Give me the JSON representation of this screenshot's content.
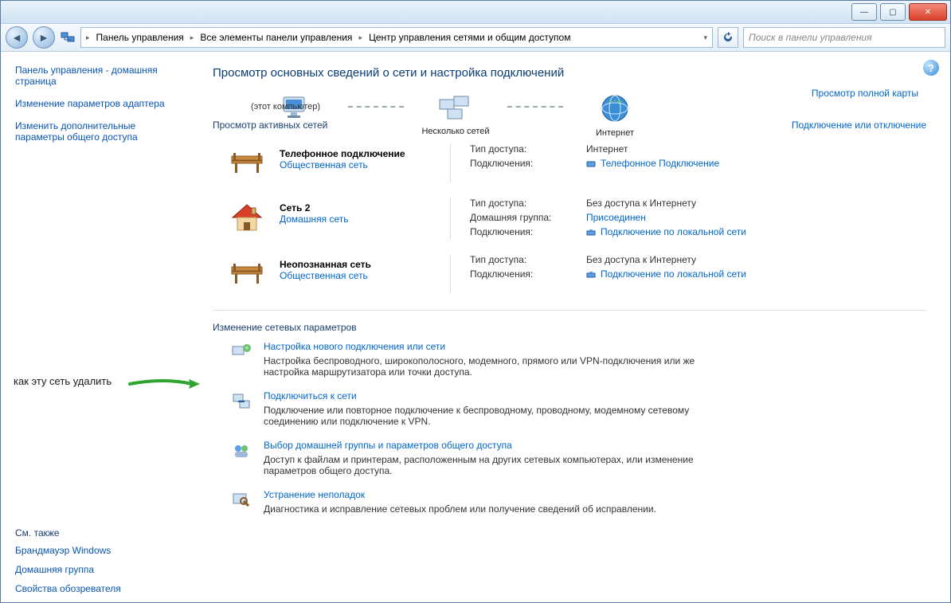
{
  "titlebar": {
    "min": "—",
    "max": "▢",
    "close": "✕"
  },
  "nav": {
    "back": "◄",
    "fwd": "►"
  },
  "breadcrumb": {
    "b1": "Панель управления",
    "b2": "Все элементы панели управления",
    "b3": "Центр управления сетями и общим доступом"
  },
  "search": {
    "placeholder": "Поиск в панели управления"
  },
  "sidebar": {
    "home": "Панель управления - домашняя страница",
    "adapter": "Изменение параметров адаптера",
    "sharing": "Изменить дополнительные параметры общего доступа",
    "see_also_heading": "См. также",
    "firewall": "Брандмауэр Windows",
    "homegroup": "Домашняя группа",
    "inetopt": "Свойства обозревателя"
  },
  "main": {
    "title": "Просмотр основных сведений о сети и настройка подключений",
    "fullmap": "Просмотр полной карты",
    "node_multi": "Несколько сетей",
    "node_internet": "Интернет",
    "this_computer": "(этот компьютер)",
    "active_heading": "Просмотр активных сетей",
    "connect_disconnect": "Подключение или отключение",
    "labels": {
      "access_type": "Тип доступа:",
      "homegroup": "Домашняя группа:",
      "connections": "Подключения:"
    },
    "net1": {
      "name": "Телефонное подключение",
      "type": "Общественная сеть",
      "access": "Интернет",
      "conn": "Телефонное Подключение"
    },
    "net2": {
      "name": "Сеть  2",
      "type": "Домашняя сеть",
      "access": "Без доступа к Интернету",
      "hg": "Присоединен",
      "conn": "Подключение по локальной сети"
    },
    "net3": {
      "name": "Неопознанная сеть",
      "type": "Общественная сеть",
      "access": "Без доступа к Интернету",
      "conn": "Подключение по локальной сети"
    },
    "settings_heading": "Изменение сетевых параметров",
    "t1": {
      "title": "Настройка нового подключения или сети",
      "desc": "Настройка беспроводного, широкополосного, модемного, прямого или VPN-подключения или же настройка маршрутизатора или точки доступа."
    },
    "t2": {
      "title": "Подключиться к сети",
      "desc": "Подключение или повторное подключение к беспроводному, проводному, модемному сетевому соединению или подключение к VPN."
    },
    "t3": {
      "title": "Выбор домашней группы и параметров общего доступа",
      "desc": "Доступ к файлам и принтерам, расположенным на других сетевых компьютерах, или изменение параметров общего доступа."
    },
    "t4": {
      "title": "Устранение неполадок",
      "desc": "Диагностика и исправление сетевых проблем или получение сведений об исправлении."
    }
  },
  "annotation": {
    "text": "как эту сеть удалить"
  }
}
